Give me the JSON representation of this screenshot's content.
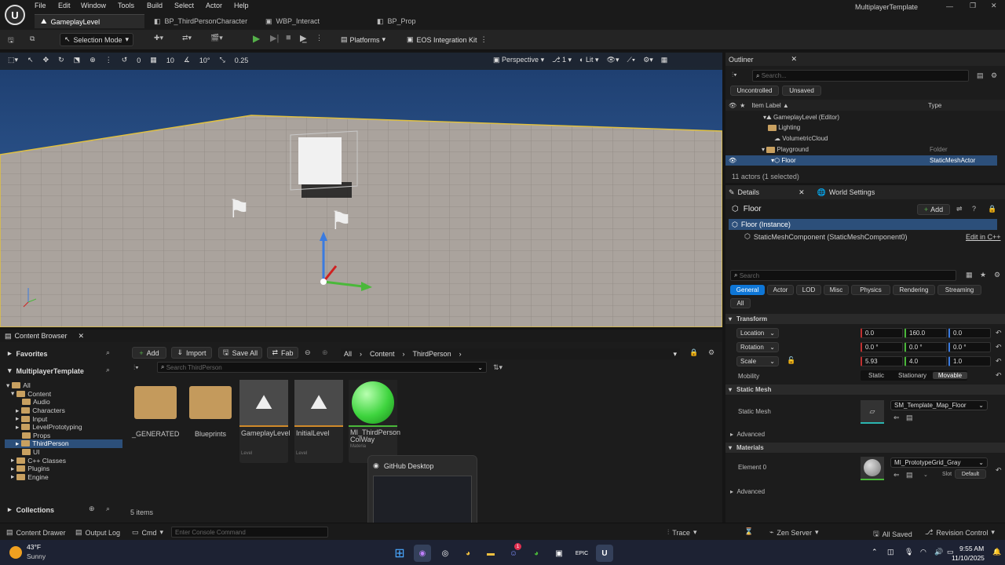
{
  "app": {
    "window_title": "MultiplayerTemplate"
  },
  "menu": [
    "File",
    "Edit",
    "Window",
    "Tools",
    "Build",
    "Select",
    "Actor",
    "Help"
  ],
  "tabs": [
    "GameplayLevel",
    "BP_ThirdPersonCharacter",
    "WBP_Interact",
    "BP_Prop"
  ],
  "toolbar": {
    "selection_mode": "Selection Mode",
    "platforms": "Platforms",
    "eos": "EOS Integration Kit"
  },
  "viewport_toolbar": {
    "rot_snap": "0",
    "grid": "10",
    "angle": "10°",
    "scale": "0.25",
    "perspective": "Perspective",
    "cam_speed": "1",
    "lit": "Lit"
  },
  "outliner": {
    "title": "Outliner",
    "search_placeholder": "Search...",
    "filters": [
      "Uncontrolled",
      "Unsaved"
    ],
    "col_label": "Item Label ▲",
    "col_type": "Type",
    "rows": [
      {
        "label": "GameplayLevel (Editor)",
        "type": ""
      },
      {
        "label": "Lighting",
        "type": ""
      },
      {
        "label": "VolumetricCloud",
        "type": ""
      },
      {
        "label": "Playground",
        "type": "Folder"
      },
      {
        "label": "Floor",
        "type": "StaticMeshActor"
      }
    ],
    "status": "11 actors (1 selected)"
  },
  "details": {
    "tab_details": "Details",
    "tab_world": "World Settings",
    "object_name": "Floor",
    "add_label": "Add",
    "instance": "Floor (Instance)",
    "component": "StaticMeshComponent (StaticMeshComponent0)",
    "edit_cpp": "Edit in C++",
    "search_placeholder": "Search",
    "filter_tabs": [
      "General",
      "Actor",
      "LOD",
      "Misc",
      "Physics",
      "Rendering",
      "Streaming",
      "All"
    ],
    "transform_title": "Transform",
    "location_label": "Location",
    "location": [
      "0.0",
      "160.0",
      "0.0"
    ],
    "rotation_label": "Rotation",
    "rotation": [
      "0.0 °",
      "0.0 °",
      "0.0 °"
    ],
    "scale_label": "Scale",
    "scale": [
      "5.93",
      "4.0",
      "1.0"
    ],
    "mobility_label": "Mobility",
    "mobility_options": [
      "Static",
      "Stationary",
      "Movable"
    ],
    "static_mesh_title": "Static Mesh",
    "static_mesh_label": "Static Mesh",
    "static_mesh_value": "SM_Template_Map_Floor",
    "advanced": "Advanced",
    "materials_title": "Materials",
    "element0_label": "Element 0",
    "material_value": "MI_PrototypeGrid_Gray",
    "slot": "Slot",
    "default": "Default",
    "advanced2": "Advanced"
  },
  "content_browser": {
    "title": "Content Browser",
    "favorites": "Favorites",
    "root": "MultiplayerTemplate",
    "add": "Add",
    "import": "Import",
    "save_all": "Save All",
    "fab": "Fab",
    "breadcrumb": [
      "All",
      "Content",
      "ThirdPerson"
    ],
    "search_placeholder": "Search ThirdPerson",
    "tree": [
      "All",
      "Content",
      "Audio",
      "Characters",
      "Input",
      "LevelPrototyping",
      "Props",
      "ThirdPerson",
      "UI",
      "C++ Classes",
      "Plugins",
      "Engine"
    ],
    "assets": [
      {
        "name": "_GENERATED",
        "kind": "folder",
        "sub": ""
      },
      {
        "name": "Blueprints",
        "kind": "folder",
        "sub": ""
      },
      {
        "name": "GameplayLevel",
        "kind": "level",
        "sub": "Level"
      },
      {
        "name": "InitialLevel",
        "kind": "level",
        "sub": "Level"
      },
      {
        "name": "MI_ThirdPerson ColWay",
        "kind": "material",
        "sub": "Materia"
      }
    ],
    "count": "5 items",
    "collections": "Collections"
  },
  "popup": {
    "title": "GitHub Desktop"
  },
  "status_bar": {
    "content_drawer": "Content Drawer",
    "output_log": "Output Log",
    "cmd": "Cmd",
    "console_placeholder": "Enter Console Command",
    "trace": "Trace",
    "zen": "Zen Server",
    "saved": "All Saved",
    "revision": "Revision Control"
  },
  "taskbar": {
    "temp": "43°F",
    "weather": "Sunny",
    "time": "9:55 AM",
    "date": "11/10/2025",
    "badge": "1"
  },
  "colors": {
    "accent": "#0e76d6",
    "selection": "#2c4f7a",
    "play": "#55b04a"
  }
}
